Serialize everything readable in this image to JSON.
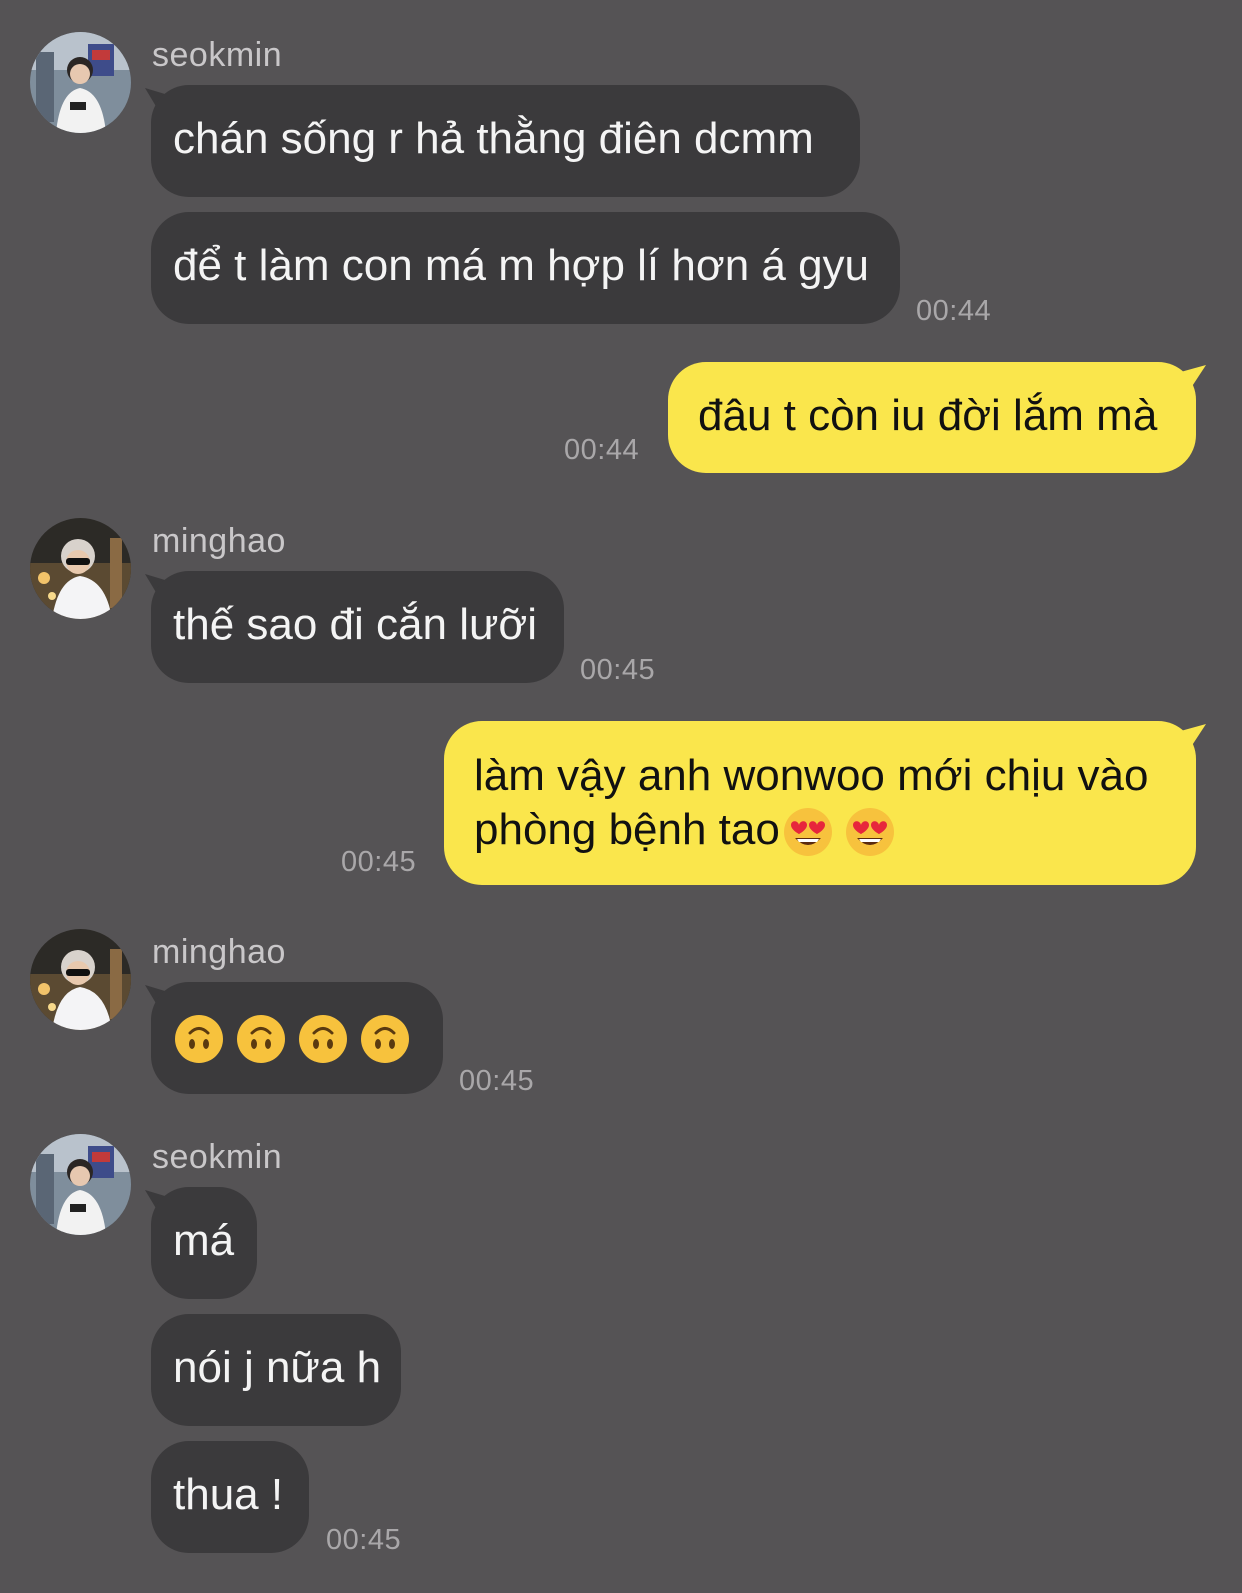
{
  "colors": {
    "background": "#555355",
    "incoming_bubble": "#3b3a3c",
    "outgoing_bubble": "#fae64c",
    "timestamp": "#a9a7a9"
  },
  "messages": [
    {
      "sender": "seokmin",
      "bubbles": [
        "chán sống r hả thằng điên dcmm",
        "để t làm con má m hợp lí hơn á gyu"
      ],
      "time": "00:44"
    },
    {
      "sender": "me",
      "bubbles": [
        "đâu t còn iu đời lắm mà"
      ],
      "time": "00:44"
    },
    {
      "sender": "minghao",
      "bubbles": [
        "thế sao đi cắn lưỡi"
      ],
      "time": "00:45"
    },
    {
      "sender": "me",
      "lines": [
        "làm vậy anh wonwoo mới chịu vào",
        "phòng bệnh tao"
      ],
      "emojis": [
        "heart-eyes-emoji",
        "heart-eyes-emoji"
      ],
      "time": "00:45"
    },
    {
      "sender": "minghao",
      "emojis": [
        "upside-down-face-emoji",
        "upside-down-face-emoji",
        "upside-down-face-emoji",
        "upside-down-face-emoji"
      ],
      "time": "00:45"
    },
    {
      "sender": "seokmin",
      "bubbles": [
        "má",
        "nói j nữa h",
        "thua !"
      ],
      "time": "00:45"
    }
  ]
}
